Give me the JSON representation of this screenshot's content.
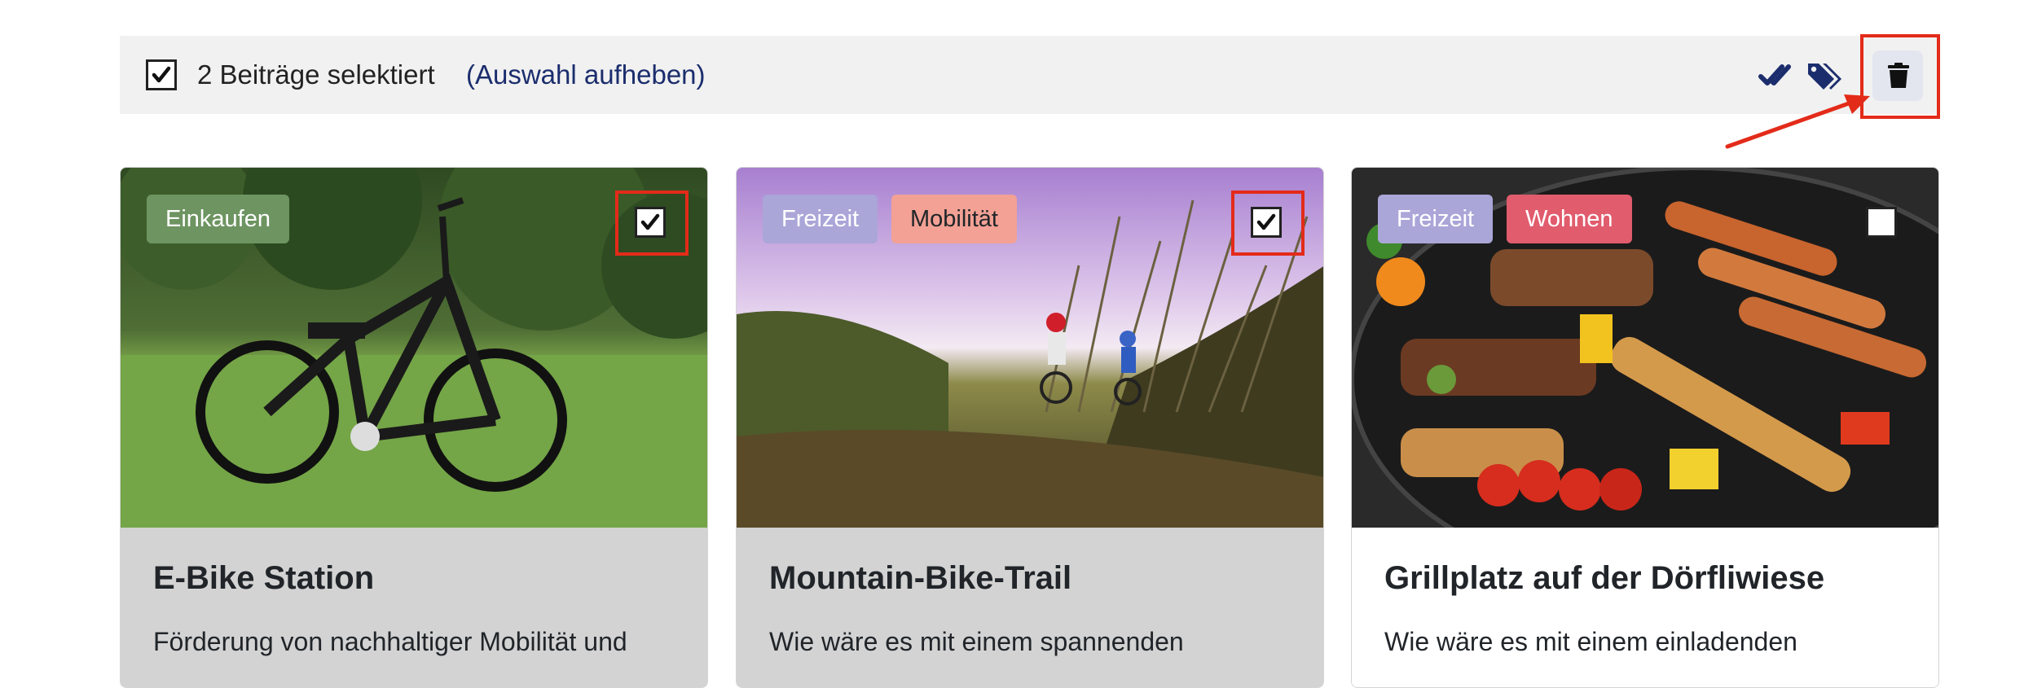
{
  "selection_bar": {
    "count_label": "2 Beiträge selektiert",
    "clear_label": "(Auswahl aufheben)",
    "actions": [
      {
        "icon": "double-check-icon"
      },
      {
        "icon": "tags-icon"
      },
      {
        "icon": "trash-icon"
      }
    ]
  },
  "colors": {
    "accent": "#1b2d6d",
    "highlight": "#e32b19",
    "tag_einkaufen": "#6d9461",
    "tag_freizeit": "#aaa6d8",
    "tag_mobilitaet": "#f2a194",
    "tag_wohnen": "#e15c6d",
    "selected_card_bg": "#d3d3d3"
  },
  "cards": [
    {
      "title": "E-Bike Station",
      "text": "Förderung von nachhaltiger Mobilität und",
      "tags": [
        "Einkaufen"
      ],
      "selected": true
    },
    {
      "title": "Mountain-Bike-Trail",
      "text": "Wie wäre es mit einem spannenden",
      "tags": [
        "Freizeit",
        "Mobilität"
      ],
      "selected": true
    },
    {
      "title": "Grillplatz auf der Dörfliwiese",
      "text": "Wie wäre es mit einem einladenden",
      "tags": [
        "Freizeit",
        "Wohnen"
      ],
      "selected": false
    }
  ]
}
